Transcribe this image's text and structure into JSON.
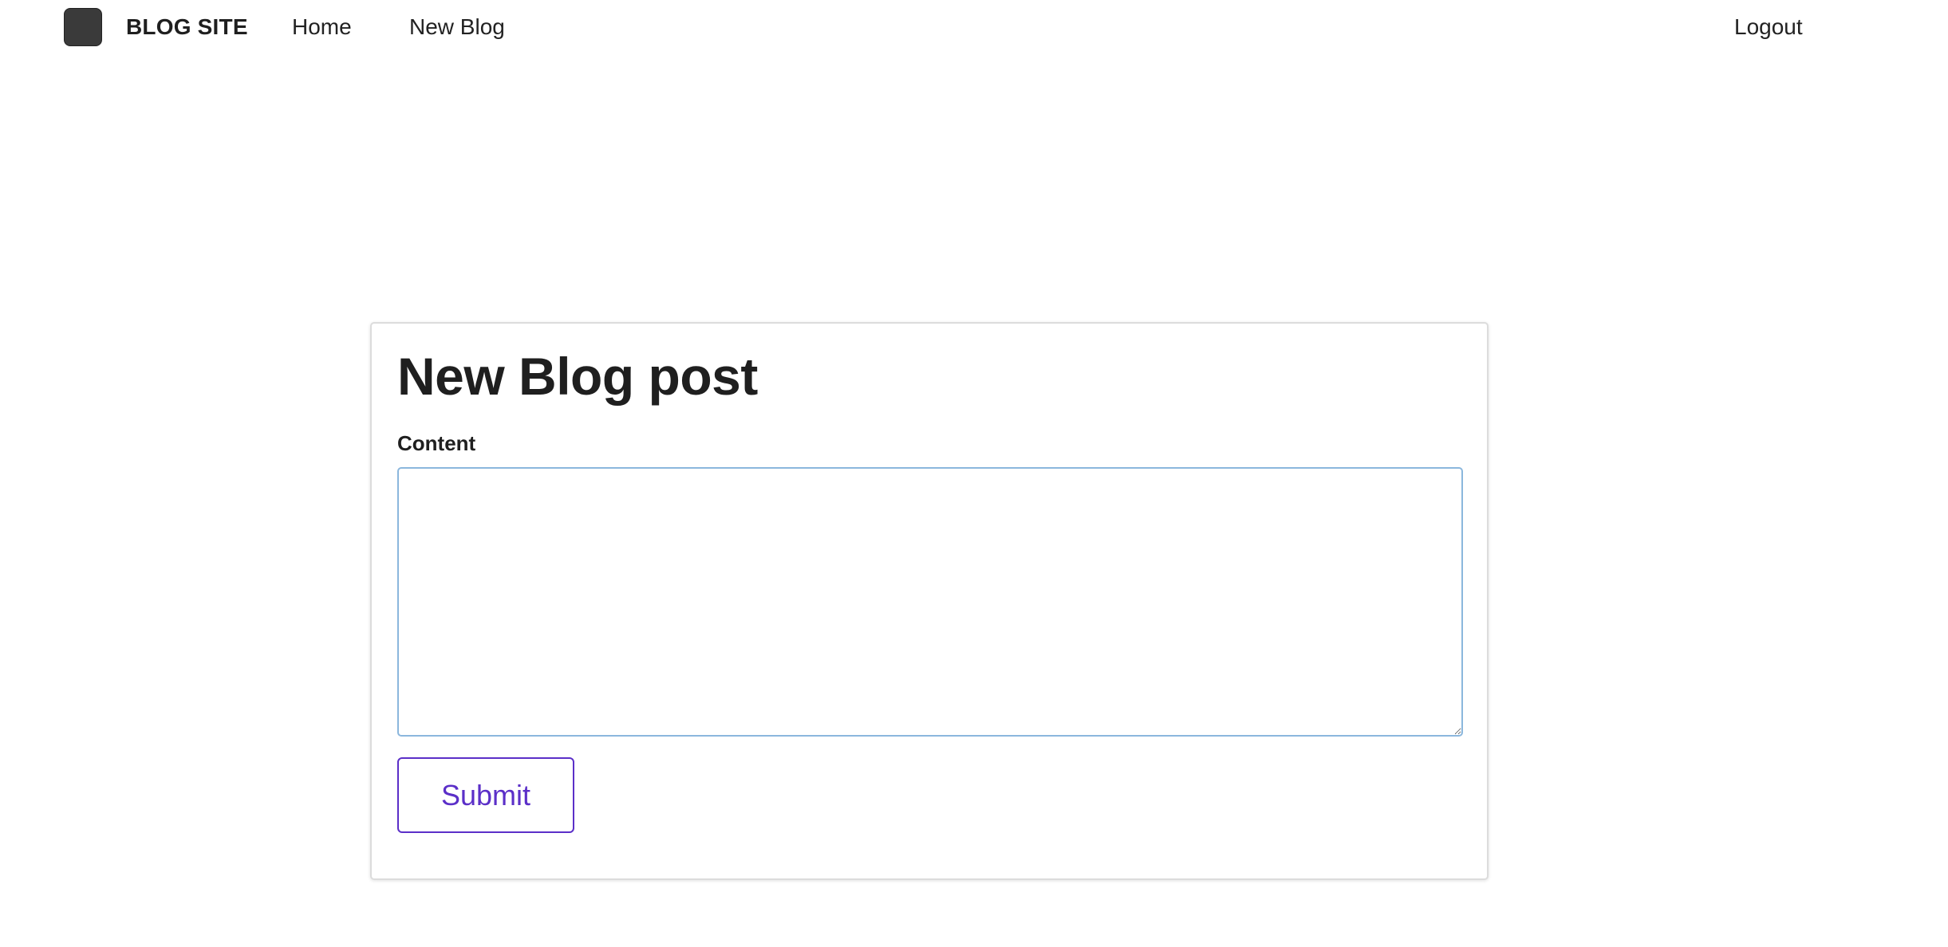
{
  "header": {
    "logo_icon": "square-logo-icon",
    "brand": "BLOG SITE",
    "nav": {
      "home": "Home",
      "new_blog": "New Blog",
      "logout": "Logout"
    }
  },
  "form": {
    "title": "New Blog post",
    "content_label": "Content",
    "content_value": "",
    "submit_label": "Submit"
  },
  "colors": {
    "accent": "#5b2fc8",
    "textarea_border": "#8bb7dd",
    "logo": "#3a3a3a"
  }
}
